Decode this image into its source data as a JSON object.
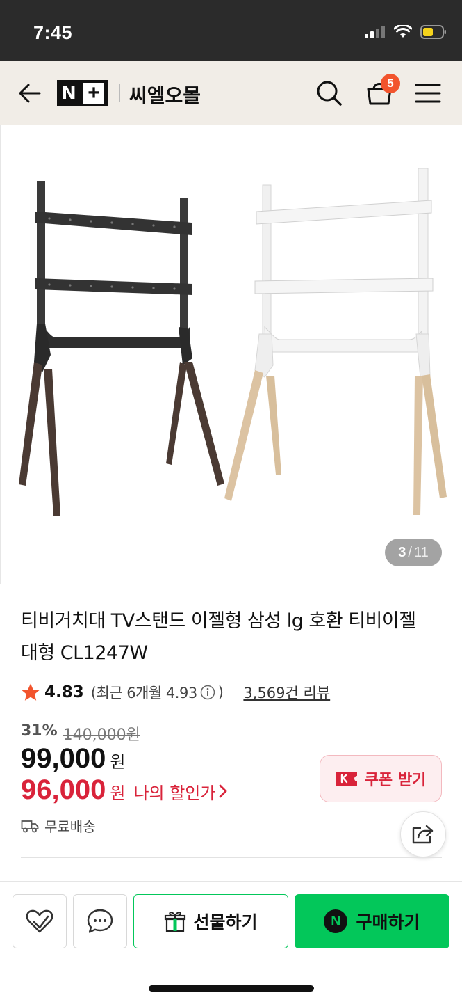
{
  "status_bar": {
    "time": "7:45"
  },
  "header": {
    "logo_letter": "N",
    "logo_plus": "+",
    "store_name": "씨엘오몰",
    "cart_count": "5",
    "icons": [
      "back-arrow-icon",
      "search-icon",
      "cart-icon",
      "hamburger-menu-icon"
    ]
  },
  "gallery": {
    "current": "3",
    "separator": "/",
    "total": "11"
  },
  "product": {
    "title": "티비거치대 TV스탠드 이젤형 삼성 lg 호환 티비이젤 대형 CL1247W",
    "rating": "4.83",
    "recent_rating_text": "(최근 6개월 4.93",
    "recent_rating_close": ")",
    "review_count_text": "3,569건 리뷰",
    "discount_rate": "31%",
    "original_price": "140,000원",
    "sale_price": "99,000",
    "sale_unit": "원",
    "my_price": "96,000",
    "my_price_unit": "원",
    "my_price_label": "나의 할인가",
    "coupon_label": "쿠폰 받기",
    "shipping_text": "무료배송"
  },
  "bottom_bar": {
    "gift_label": "선물하기",
    "buy_badge": "N",
    "buy_label": "구매하기"
  },
  "colors": {
    "header_bg": "#f1ede7",
    "accent_red": "#d9233a",
    "naver_green": "#03c75a",
    "badge_orange": "#f2542d"
  }
}
